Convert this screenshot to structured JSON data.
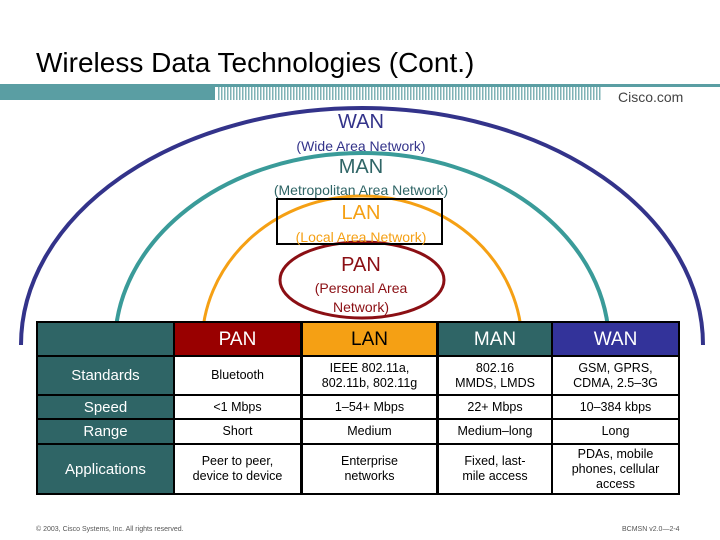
{
  "title": "Wireless Data Technologies (Cont.)",
  "brand": "Cisco.com",
  "colors": {
    "wan": "#33338a",
    "man": "#3a9b99",
    "lan": "#f5a014",
    "pan": "#8b0f14",
    "teal": "#2f6566",
    "banner": "#5a9ea3"
  },
  "rings": {
    "wan": {
      "name": "WAN",
      "full": "(Wide Area Network)"
    },
    "man": {
      "name": "MAN",
      "full": "(Metropolitan Area Network)"
    },
    "lan": {
      "name": "LAN",
      "full": "(Local Area Network)"
    },
    "pan": {
      "name": "PAN",
      "full1": "(Personal Area",
      "full2": "Network)"
    }
  },
  "table": {
    "headers": [
      "PAN",
      "LAN",
      "MAN",
      "WAN"
    ],
    "rows": [
      {
        "label": "Standards",
        "cells": [
          [
            "Bluetooth"
          ],
          [
            "IEEE 802.11a,",
            "802.11b, 802.11g"
          ],
          [
            "802.16",
            "MMDS, LMDS"
          ],
          [
            "GSM, GPRS,",
            "CDMA, 2.5–3G"
          ]
        ]
      },
      {
        "label": "Speed",
        "cells": [
          [
            "<1 Mbps"
          ],
          [
            "1–54+ Mbps"
          ],
          [
            "22+ Mbps"
          ],
          [
            "10–384 kbps"
          ]
        ]
      },
      {
        "label": "Range",
        "cells": [
          [
            "Short"
          ],
          [
            "Medium"
          ],
          [
            "Medium–long"
          ],
          [
            "Long"
          ]
        ]
      },
      {
        "label": "Applications",
        "cells": [
          [
            "Peer to peer,",
            "device to device"
          ],
          [
            "Enterprise",
            "networks"
          ],
          [
            "Fixed, last-",
            "mile access"
          ],
          [
            "PDAs, mobile",
            "phones, cellular",
            "access"
          ]
        ]
      }
    ]
  },
  "footer": {
    "left": "© 2003, Cisco Systems, Inc. All rights reserved.",
    "right": "BCMSN v2.0—2-4"
  }
}
